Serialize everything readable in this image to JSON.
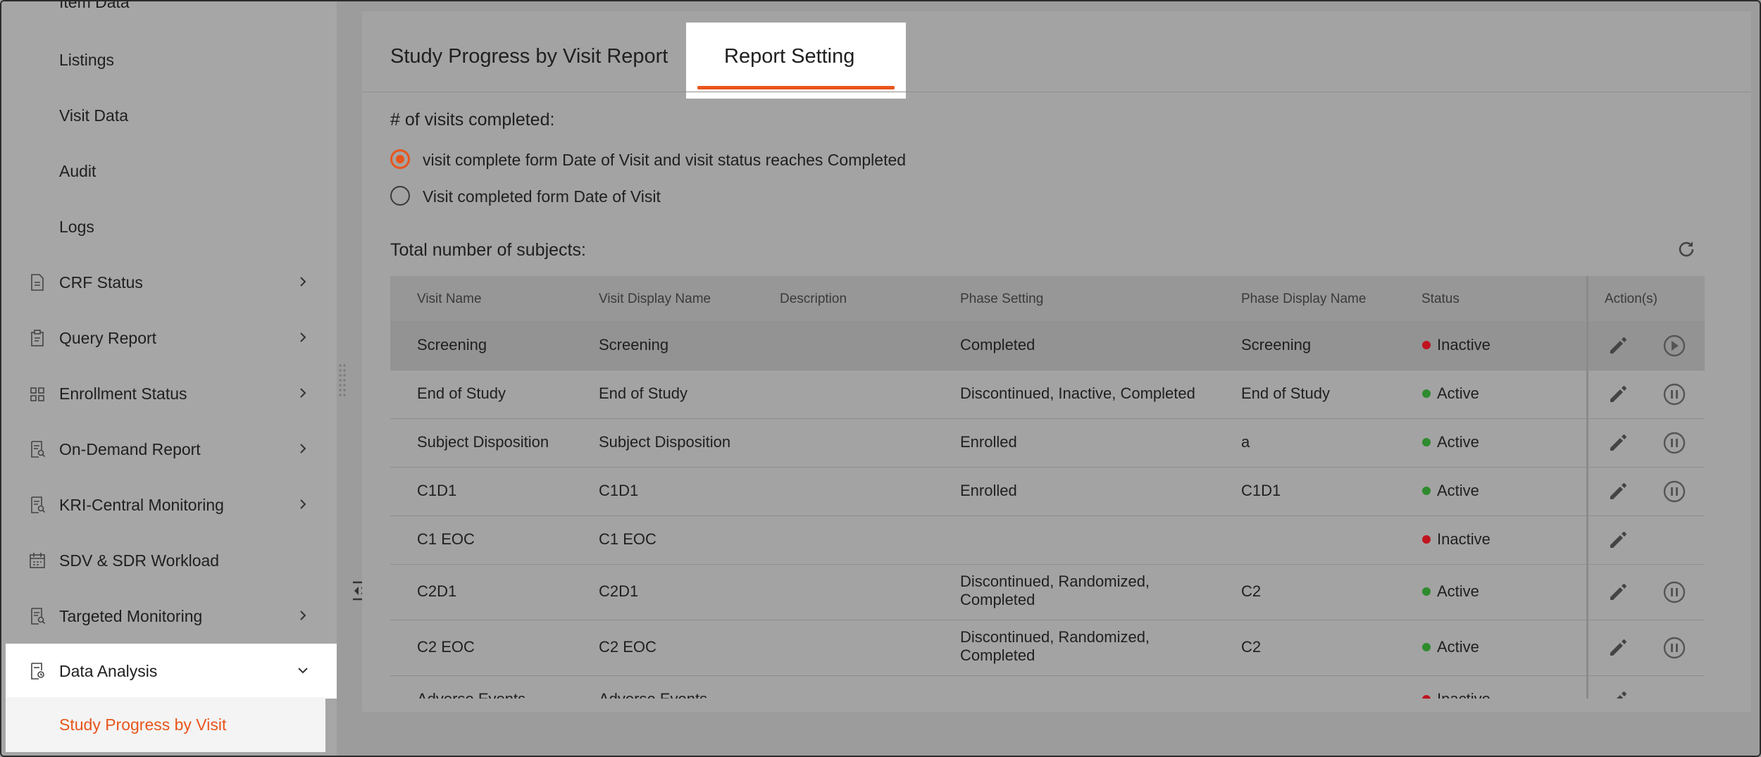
{
  "sidebar": {
    "sub_items": [
      "Item Data",
      "Listings",
      "Visit Data",
      "Audit",
      "Logs"
    ],
    "menu_items": [
      {
        "label": "CRF Status",
        "icon": "document-icon"
      },
      {
        "label": "Query Report",
        "icon": "clipboard-icon"
      },
      {
        "label": "Enrollment Status",
        "icon": "grid-icon"
      },
      {
        "label": "On-Demand Report",
        "icon": "report-search-icon"
      },
      {
        "label": "KRI-Central Monitoring",
        "icon": "report-search-icon"
      },
      {
        "label": "SDV & SDR Workload",
        "icon": "calendar-icon"
      },
      {
        "label": "Targeted Monitoring",
        "icon": "report-search-icon"
      },
      {
        "label": "Data Analysis",
        "icon": "analysis-doc-icon"
      }
    ],
    "active_sub_item": "Study Progress by Visit"
  },
  "tabs": {
    "report": "Study Progress by Visit Report",
    "setting": "Report Setting"
  },
  "settings": {
    "visits_title": "# of visits completed:",
    "option_1": "visit complete form Date of Visit and visit status reaches Completed",
    "option_2": "Visit completed form Date of Visit",
    "subjects_title": "Total number of subjects:"
  },
  "table": {
    "headers": {
      "visit_name": "Visit Name",
      "visit_display_name": "Visit Display Name",
      "description": "Description",
      "phase_setting": "Phase Setting",
      "phase_display_name": "Phase Display Name",
      "status": "Status",
      "actions": "Action(s)"
    },
    "rows": [
      {
        "visit_name": "Screening",
        "visit_display_name": "Screening",
        "description": "",
        "phase_setting": "Completed",
        "phase_display_name": "Screening",
        "status": "Inactive"
      },
      {
        "visit_name": "End of Study",
        "visit_display_name": "End of Study",
        "description": "",
        "phase_setting": "Discontinued, Inactive, Completed",
        "phase_display_name": "End of Study",
        "status": "Active"
      },
      {
        "visit_name": "Subject Disposition",
        "visit_display_name": "Subject Disposition",
        "description": "",
        "phase_setting": "Enrolled",
        "phase_display_name": "a",
        "status": "Active"
      },
      {
        "visit_name": "C1D1",
        "visit_display_name": "C1D1",
        "description": "",
        "phase_setting": "Enrolled",
        "phase_display_name": "C1D1",
        "status": "Active"
      },
      {
        "visit_name": "C1 EOC",
        "visit_display_name": "C1 EOC",
        "description": "",
        "phase_setting": "",
        "phase_display_name": "",
        "status": "Inactive"
      },
      {
        "visit_name": "C2D1",
        "visit_display_name": "C2D1",
        "description": "",
        "phase_setting_line1": "Discontinued, Randomized,",
        "phase_setting_line2": "Completed",
        "phase_display_name": "C2",
        "status": "Active"
      },
      {
        "visit_name": "C2 EOC",
        "visit_display_name": "C2 EOC",
        "description": "",
        "phase_setting_line1": "Discontinued, Randomized,",
        "phase_setting_line2": "Completed",
        "phase_display_name": "C2",
        "status": "Active"
      },
      {
        "visit_name": "Adverse Events",
        "visit_display_name": "Adverse Events",
        "description": "",
        "phase_setting": "",
        "phase_display_name": "",
        "status": "Inactive"
      }
    ]
  },
  "colors": {
    "accent": "#e8551c",
    "active_dot": "#2e8b2e",
    "inactive_dot": "#c0141e"
  }
}
